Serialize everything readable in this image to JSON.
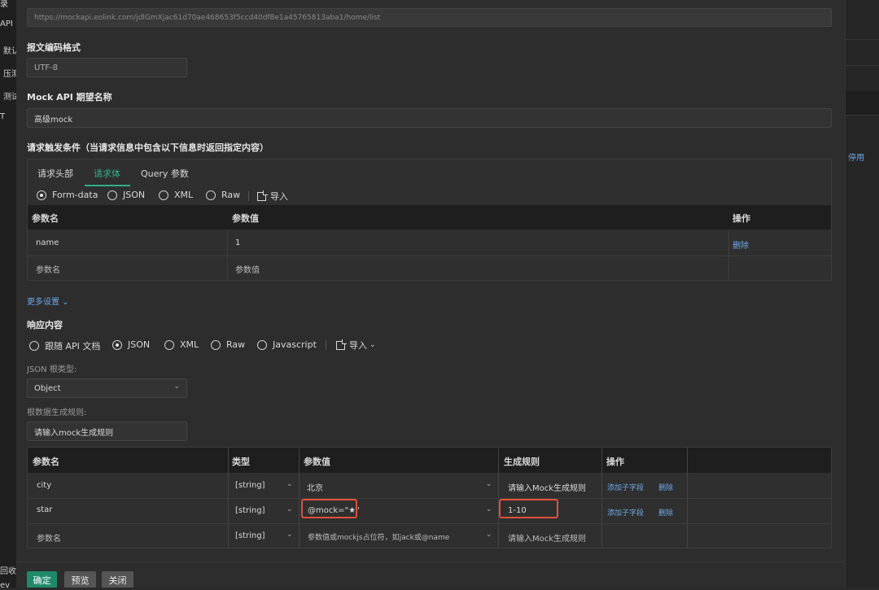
{
  "left_nav": [
    "录",
    "API",
    "默认",
    "压测",
    "测试",
    "T",
    "回收站",
    "ev"
  ],
  "right_strip": {
    "stop_label": "停用"
  },
  "url_field": {
    "value": "https://mockapi.eolink.com/jdlGmXjac61d70ae468653f5ccd40df8e1a45765813aba1/home/list"
  },
  "encoding": {
    "label": "报文编码格式",
    "value": "UTF-8"
  },
  "mock_name": {
    "label": "Mock API 期望名称",
    "value": "高级mock"
  },
  "trigger": {
    "label": "请求触发条件（当请求信息中包含以下信息时返回指定内容）",
    "tabs": [
      "请求头部",
      "请求体",
      "Query 参数"
    ],
    "active_tab": "请求体",
    "body_types": [
      "Form-data",
      "JSON",
      "XML",
      "Raw"
    ],
    "selected_body_type": "Form-data",
    "import_label": "导入",
    "headers": {
      "name": "参数名",
      "value": "参数值",
      "action": "操作"
    },
    "rows": [
      {
        "name": "name",
        "value": "1",
        "action": "删除"
      },
      {
        "name": "参数名",
        "value": "参数值",
        "action": ""
      }
    ]
  },
  "more_settings": "更多设置 ⌄",
  "response": {
    "label": "响应内容",
    "types": [
      "跟随 API 文档",
      "JSON",
      "XML",
      "Raw",
      "Javascript"
    ],
    "selected_type": "JSON",
    "import_label": "导入",
    "root_type_label": "JSON 根类型:",
    "root_type_value": "Object",
    "root_rule_label": "根数据生成规则:",
    "root_rule_placeholder": "请输入mock生成规则",
    "headers": {
      "name": "参数名",
      "type": "类型",
      "value": "参数值",
      "rule": "生成规则",
      "action": "操作"
    },
    "rows": [
      {
        "name": "city",
        "type": "[string]",
        "value": "北京",
        "rule": "请输入Mock生成规则",
        "add": "添加子字段",
        "del": "删除"
      },
      {
        "name": "star",
        "type": "[string]",
        "value": "@mock=\"★\"",
        "rule": "1-10",
        "add": "添加子字段",
        "del": "删除"
      },
      {
        "name": "参数名",
        "type": "[string]",
        "value": "参数值或mockjs占位符，如jack或@name",
        "rule": "请输入Mock生成规则",
        "add": "",
        "del": ""
      }
    ]
  },
  "footer": {
    "confirm": "确定",
    "preview": "预览",
    "close": "关闭"
  },
  "colors": {
    "accent": "#2fb08a",
    "link": "#6fa8e8",
    "highlight": "#e0503a"
  }
}
